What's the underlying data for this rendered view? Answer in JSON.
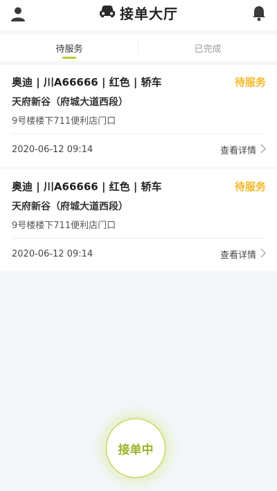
{
  "header": {
    "title": "接单大厅",
    "left_icon": "user-icon",
    "title_icon": "car-front-icon",
    "right_icon": "bell-icon"
  },
  "tabs": [
    {
      "label": "待服务",
      "active": true
    },
    {
      "label": "已完成",
      "active": false
    }
  ],
  "orders": [
    {
      "car_info": "奥迪 | 川A66666 | 红色 | 轿车",
      "status": "待服务",
      "place": "天府新谷（府城大道西段）",
      "address": "9号楼楼下711便利店门口",
      "time": "2020-06-12 09:14",
      "detail_label": "查看详情"
    },
    {
      "car_info": "奥迪 | 川A66666 | 红色 | 轿车",
      "status": "待服务",
      "place": "天府新谷（府城大道西段）",
      "address": "9号楼楼下711便利店门口",
      "time": "2020-06-12 09:14",
      "detail_label": "查看详情"
    }
  ],
  "accept_button": {
    "label": "接单中"
  },
  "colors": {
    "accent": "#b7cc2c",
    "status": "#f2b826",
    "background": "#f3f7fa"
  }
}
